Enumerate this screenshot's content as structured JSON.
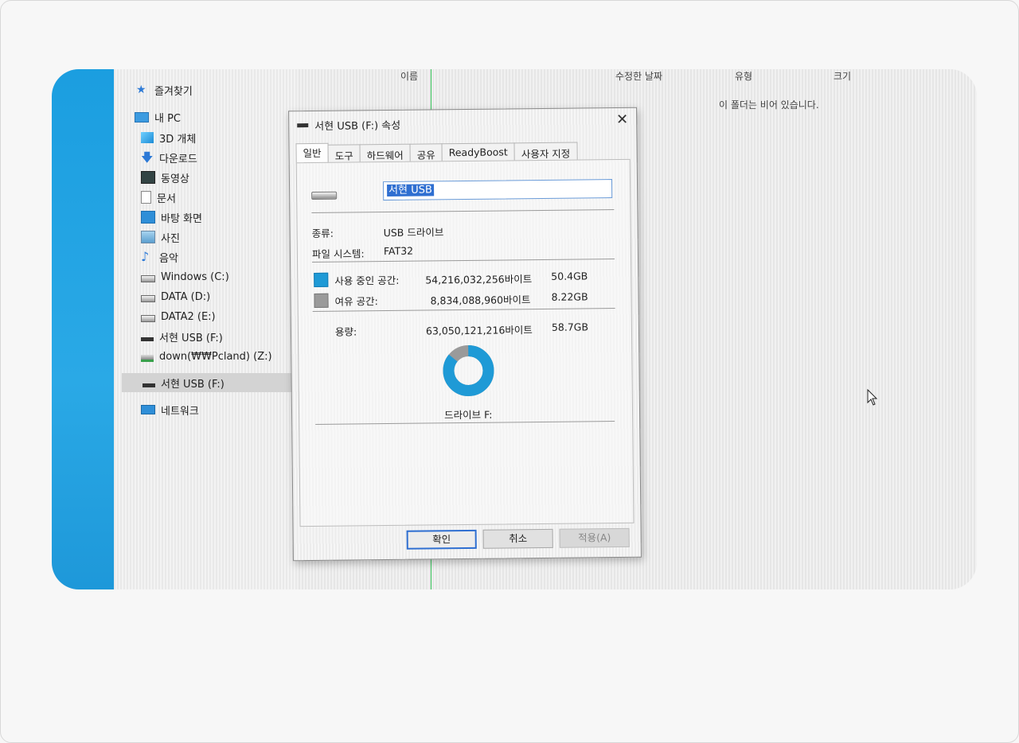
{
  "nav": {
    "quick_access": "즐겨찾기",
    "this_pc": "내 PC",
    "items": [
      {
        "label": "3D 개체",
        "icon": "cube-icon"
      },
      {
        "label": "다운로드",
        "icon": "download-arrow-icon"
      },
      {
        "label": "동영상",
        "icon": "video-icon"
      },
      {
        "label": "문서",
        "icon": "document-icon"
      },
      {
        "label": "바탕 화면",
        "icon": "desktop-icon"
      },
      {
        "label": "사진",
        "icon": "picture-icon"
      },
      {
        "label": "음악",
        "icon": "music-note-icon"
      },
      {
        "label": "Windows (C:)",
        "icon": "drive-windows-icon"
      },
      {
        "label": "DATA (D:)",
        "icon": "drive-icon"
      },
      {
        "label": "DATA2 (E:)",
        "icon": "drive-icon"
      },
      {
        "label": "서현 USB (F:)",
        "icon": "usb-drive-icon"
      },
      {
        "label": "down(₩₩Pcland) (Z:)",
        "icon": "network-drive-icon"
      }
    ],
    "selected": "서현 USB (F:)",
    "network": "네트워크"
  },
  "columns": {
    "name": "이름",
    "modified": "수정한 날짜",
    "type": "유형",
    "size": "크기"
  },
  "empty_message": "이 폴더는 비어 있습니다.",
  "dialog": {
    "title": "서현 USB (F:) 속성",
    "tabs": [
      "일반",
      "도구",
      "하드웨어",
      "공유",
      "ReadyBoost",
      "사용자 지정"
    ],
    "active_tab": "일반",
    "volume_name": "서현 USB",
    "type_label": "종류:",
    "type_value": "USB 드라이브",
    "fs_label": "파일 시스템:",
    "fs_value": "FAT32",
    "used": {
      "label": "사용 중인 공간:",
      "bytes": "54,216,032,256바이트",
      "size": "50.4GB"
    },
    "free": {
      "label": "여유 공간:",
      "bytes": "8,834,088,960바이트",
      "size": "8.22GB"
    },
    "capacity": {
      "label": "용량:",
      "bytes": "63,050,121,216바이트",
      "size": "58.7GB"
    },
    "used_fraction": 0.86,
    "drive_label": "드라이브 F:",
    "buttons": {
      "ok": "확인",
      "cancel": "취소",
      "apply": "적용(A)"
    },
    "colors": {
      "used": "#1f9ad6",
      "free": "#9a9a9a"
    }
  }
}
